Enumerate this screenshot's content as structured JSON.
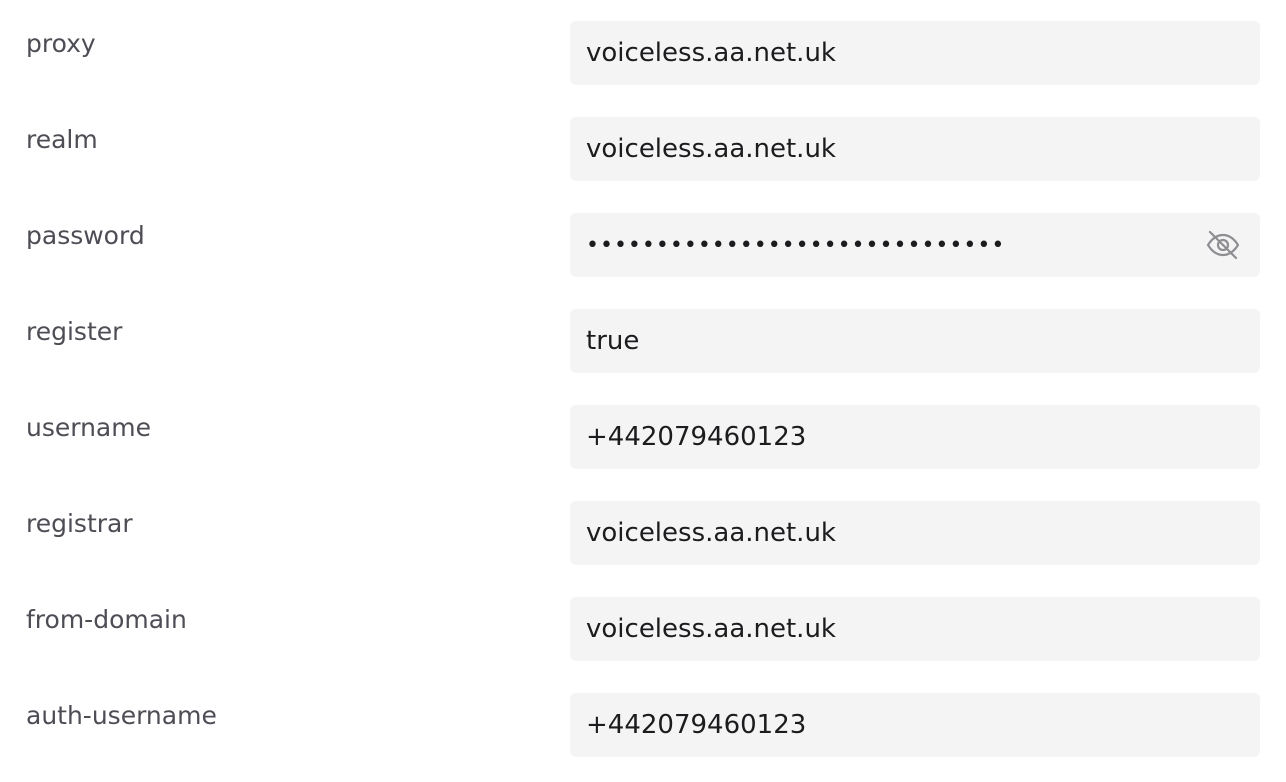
{
  "fields": [
    {
      "key": "proxy",
      "label": "proxy",
      "value": "voiceless.aa.net.uk",
      "type": "text"
    },
    {
      "key": "realm",
      "label": "realm",
      "value": "voiceless.aa.net.uk",
      "type": "text"
    },
    {
      "key": "password",
      "label": "password",
      "value": "••••••••••••••••••••••••••••••",
      "type": "password",
      "toggle_icon": "eye-slash-icon"
    },
    {
      "key": "register",
      "label": "register",
      "value": "true",
      "type": "text"
    },
    {
      "key": "username",
      "label": "username",
      "value": "+442079460123",
      "type": "text"
    },
    {
      "key": "registrar",
      "label": "registrar",
      "value": "voiceless.aa.net.uk",
      "type": "text"
    },
    {
      "key": "from-domain",
      "label": "from-domain",
      "value": "voiceless.aa.net.uk",
      "type": "text"
    },
    {
      "key": "auth-username",
      "label": "auth-username",
      "value": "+442079460123",
      "type": "text"
    }
  ],
  "colors": {
    "field_background": "#f4f4f5",
    "label_text": "#4d4d55",
    "value_text": "#1c1c1e",
    "icon": "#8e8e93"
  }
}
